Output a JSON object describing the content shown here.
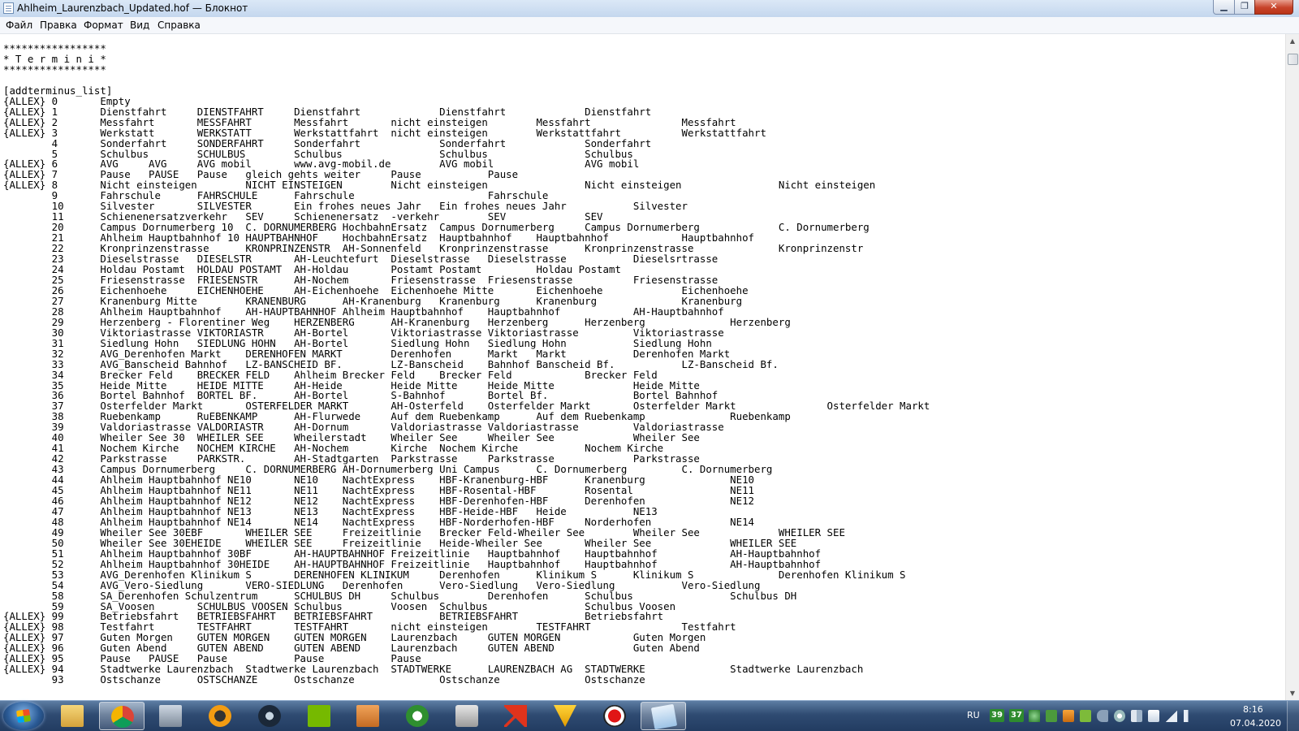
{
  "window": {
    "title": "Ahlheim_Laurenzbach_Updated.hof — Блокнот",
    "minimize_glyph": "▁",
    "maximize_glyph": "❐",
    "close_glyph": "✕"
  },
  "menu": {
    "file": "Файл",
    "edit": "Правка",
    "format": "Формат",
    "view": "Вид",
    "help": "Справка"
  },
  "editor": {
    "lines": [
      "*****************",
      "* T e r m i n i *",
      "*****************",
      "",
      "[addterminus_list]",
      "{ALLEX} 0       Empty",
      "{ALLEX} 1       Dienstfahrt     DIENSTFAHRT     Dienstfahrt             Dienstfahrt             Dienstfahrt",
      "{ALLEX} 2       Messfahrt       MESSFAHRT       Messfahrt       nicht einsteigen        Messfahrt               Messfahrt",
      "{ALLEX} 3       Werkstatt       WERKSTATT       Werkstattfahrt  nicht einsteigen        Werkstattfahrt          Werkstattfahrt",
      "        4       Sonderfahrt     SONDERFAHRT     Sonderfahrt             Sonderfahrt             Sonderfahrt",
      "        5       Schulbus        SCHULBUS        Schulbus                Schulbus                Schulbus",
      "{ALLEX} 6       AVG     AVG     AVG mobil       www.avg-mobil.de        AVG mobil               AVG mobil",
      "{ALLEX} 7       Pause   PAUSE   Pause   gleich gehts weiter     Pause           Pause",
      "{ALLEX} 8       Nicht einsteigen        NICHT EINSTEIGEN        Nicht einsteigen                Nicht einsteigen                Nicht einsteigen",
      "        9       Fahrschule      FAHRSCHULE      Fahrschule                      Fahrschule",
      "        10      Silvester       SILVESTER       Ein frohes neues Jahr   Ein frohes neues Jahr           Silvester",
      "        11      Schienenersatzverkehr   SEV     Schienenersatz  -verkehr        SEV             SEV",
      "        20      Campus Dornumerberg 10  C. DORNUMERBERG HochbahnErsatz  Campus Dornumerberg     Campus Dornumerberg             C. Dornumerberg",
      "        21      Ahlheim Hauptbahnhof 10 HAUPTBAHNHOF    HochbahnErsatz  Hauptbahnhof    Hauptbahnhof            Hauptbahnhof",
      "        22      Kronprinzenstrasse      KRONPRINZENSTR  AH-Sonnenfeld   Kronprinzenstrasse      Kronprinzenstrasse              Kronprinzenstr",
      "        23      Dieselstrasse   DIESELSTR       AH-Leuchtefurt  Dieselstrasse   Dieselstrasse           Dieselsrtrasse",
      "        24      Holdau Postamt  HOLDAU POSTAMT  AH-Holdau       Postamt Postamt         Holdau Postamt",
      "        25      Friesenstrasse  FRIESENSTR      AH-Nochem       Friesenstrasse  Friesenstrasse          Friesenstrasse",
      "        26      Eichenhoehe     EICHENHOEHE     AH-Eichenhoehe  Eichenhoehe Mitte       Eichenhoehe             Eichenhoehe",
      "        27      Kranenburg Mitte        KRANENBURG      AH-Kranenburg   Kranenburg      Kranenburg              Kranenburg",
      "        28      Ahlheim Hauptbahnhof    AH-HAUPTBAHNHOF Ahlheim Hauptbahnhof    Hauptbahnhof            AH-Hauptbahnhof",
      "        29      Herzenberg - Florentiner Weg    HERZENBERG      AH-Kranenburg   Herzenberg      Herzenberg              Herzenberg",
      "        30      Viktoriastrasse VIKTORIASTR     AH-Bortel       Viktoriastrasse Viktoriastrasse         Viktoriastrasse",
      "        31      Siedlung Hohn   SIEDLUNG HOHN   AH-Bortel       Siedlung Hohn   Siedlung Hohn           Siedlung Hohn",
      "        32      AVG_Derenhofen Markt    DERENHOFEN MARKT        Derenhofen      Markt   Markt           Derenhofen Markt",
      "        33      AVG_Banscheid Bahnhof   LZ-BANSCHEID BF.        LZ-Banscheid    Bahnhof Banscheid Bf.           LZ-Banscheid Bf.",
      "        34      Brecker Feld    BRECKER FELD    Ahlheim Brecker Feld    Brecker Feld            Brecker Feld",
      "        35      Heide Mitte     HEIDE MITTE     AH-Heide        Heide Mitte     Heide Mitte             Heide Mitte",
      "        36      Bortel Bahnhof  BORTEL BF.      AH-Bortel       S-Bahnhof       Bortel Bf.              Bortel Bahnhof",
      "        37      Osterfelder Markt       OSTERFELDER MARKT       AH-Osterfeld    Osterfelder Markt       Osterfelder Markt               Osterfelder Markt",
      "        38      Ruebenkamp      RuEBENKAMP      AH-Flurwede     Auf dem Ruebenkamp      Auf dem Ruebenkamp              Ruebenkamp",
      "        39      Valdoriastrasse VALDORIASTR     AH-Dornum       Valdoriastrasse Valdoriastrasse         Valdoriastrasse",
      "        40      Wheiler See 30  WHEILER SEE     Wheilerstadt    Wheiler See     Wheiler See             Wheiler See",
      "        41      Nochem Kirche   NOCHEM KIRCHE   AH-Nochem       Kirche  Nochem Kirche           Nochem Kirche",
      "        42      Parkstrasse     PARKSTR.        AH-Stadtgarten  Parkstrasse     Parkstrasse             Parkstrasse",
      "        43      Campus Dornumerberg     C. DORNUMERBERG AH-Dornumerberg Uni Campus      C. Dornumerberg         C. Dornumerberg",
      "        44      Ahlheim Hauptbahnhof NE10       NE10    NachtExpress    HBF-Kranenburg-HBF      Kranenburg              NE10",
      "        45      Ahlheim Hauptbahnhof NE11       NE11    NachtExpress    HBF-Rosental-HBF        Rosental                NE11",
      "        46      Ahlheim Hauptbahnhof NE12       NE12    NachtExpress    HBF-Derenhofen-HBF      Derenhofen              NE12",
      "        47      Ahlheim Hauptbahnhof NE13       NE13    NachtExpress    HBF-Heide-HBF   Heide           NE13",
      "        48      Ahlheim Hauptbahnhof NE14       NE14    NachtExpress    HBF-Norderhofen-HBF     Norderhofen             NE14",
      "        49      Wheiler See 30EBF       WHEILER SEE     Freizeitlinie   Brecker Feld-Wheiler See        Wheiler See             WHEILER SEE",
      "        50      Wheiler See 30EHEIDE    WHEILER SEE     Freizeitlinie   Heide-Wheiler See       Wheiler See             WHEILER SEE",
      "        51      Ahlheim Hauptbahnhof 30BF       AH-HAUPTBAHNHOF Freizeitlinie   Hauptbahnhof    Hauptbahnhof            AH-Hauptbahnhof",
      "        52      Ahlheim Hauptbahnhof 30HEIDE    AH-HAUPTBAHNHOF Freizeitlinie   Hauptbahnhof    Hauptbahnhof            AH-Hauptbahnhof",
      "        53      AVG_Derenhofen Klinikum S       DERENHOFEN KLINIKUM     Derenhofen      Klinikum S      Klinikum S              Derenhofen Klinikum S",
      "        54      AVG_Vero-Siedlung       VERO-SIEDLUNG   Derenhofen      Vero-Siedlung   Vero-Siedlung           Vero-Siedlung",
      "        58      SA_Derenhofen Schulzentrum      SCHULBUS DH     Schulbus        Derenhofen      Schulbus                Schulbus DH",
      "        59      SA_Voosen       SCHULBUS VOOSEN Schulbus        Voosen  Schulbus                Schulbus Voosen",
      "{ALLEX} 99      Betriebsfahrt   BETRIEBSFAHRT   BETRIEBSFAHRT           BETRIEBSFAHRT           Betriebsfahrt",
      "{ALLEX} 98      Testfahrt       TESTFAHRT       TESTFAHRT       nicht einsteigen        TESTFAHRT               Testfahrt",
      "{ALLEX} 97      Guten Morgen    GUTEN MORGEN    GUTEN MORGEN    Laurenzbach     GUTEN MORGEN            Guten Morgen",
      "{ALLEX} 96      Guten Abend     GUTEN ABEND     GUTEN ABEND     Laurenzbach     GUTEN ABEND             Guten Abend",
      "{ALLEX} 95      Pause   PAUSE   Pause           Pause           Pause",
      "{ALLEX} 94      Stadtwerke Laurenzbach  Stadtwerke Laurenzbach  STADTWERKE      LAURENZBACH AG  STADTWERKE              Stadtwerke Laurenzbach",
      "        93      Ostschanze      OSTSCHANZE      Ostschanze              Ostschanze              Ostschanze"
    ]
  },
  "taskbar": {
    "items": [
      {
        "name": "explorer-icon",
        "active": false
      },
      {
        "name": "chrome-icon",
        "active": true
      },
      {
        "name": "computer-icon",
        "active": false
      },
      {
        "name": "app-orange-icon",
        "active": false
      },
      {
        "name": "steam-icon",
        "active": false
      },
      {
        "name": "nvidia-icon",
        "active": false
      },
      {
        "name": "box-icon",
        "active": false
      },
      {
        "name": "xbox-icon",
        "active": false
      },
      {
        "name": "drive-icon",
        "active": false
      },
      {
        "name": "arrow-red-icon",
        "active": false
      },
      {
        "name": "v-app-icon",
        "active": false
      },
      {
        "name": "record-icon",
        "active": false
      },
      {
        "name": "notepad-icon",
        "active": true
      }
    ],
    "language": "RU",
    "tray_temp_1": "39",
    "tray_temp_2": "37",
    "time": "8:16",
    "date": "07.04.2020"
  }
}
